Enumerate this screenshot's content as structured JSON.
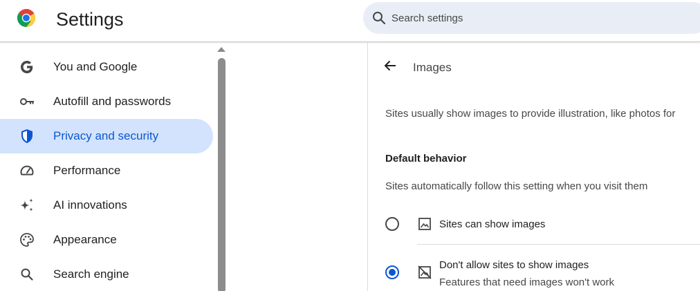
{
  "header": {
    "title": "Settings",
    "logo_icon": "chrome-logo-icon",
    "search": {
      "placeholder": "Search settings",
      "icon": "search-icon"
    }
  },
  "sidebar": {
    "items": [
      {
        "label": "You and Google",
        "icon": "google-g-icon",
        "active": false
      },
      {
        "label": "Autofill and passwords",
        "icon": "key-icon",
        "active": false
      },
      {
        "label": "Privacy and security",
        "icon": "shield-icon",
        "active": true
      },
      {
        "label": "Performance",
        "icon": "speedometer-icon",
        "active": false
      },
      {
        "label": "AI innovations",
        "icon": "sparkle-icon",
        "active": false
      },
      {
        "label": "Appearance",
        "icon": "palette-icon",
        "active": false
      },
      {
        "label": "Search engine",
        "icon": "search-icon",
        "active": false
      }
    ]
  },
  "main": {
    "title": "Images",
    "description": "Sites usually show images to provide illustration, like photos for",
    "default_behavior": {
      "heading": "Default behavior",
      "subtitle": "Sites automatically follow this setting when you visit them",
      "options": [
        {
          "label": "Sites can show images",
          "sublabel": "",
          "icon": "image-icon",
          "checked": false
        },
        {
          "label": "Don't allow sites to show images",
          "sublabel": "Features that need images won't work",
          "icon": "image-off-icon",
          "checked": true
        }
      ]
    }
  },
  "colors": {
    "accent": "#0b57d0",
    "active_nav_bg": "#d3e3fd",
    "search_bg": "#e9eef6"
  }
}
